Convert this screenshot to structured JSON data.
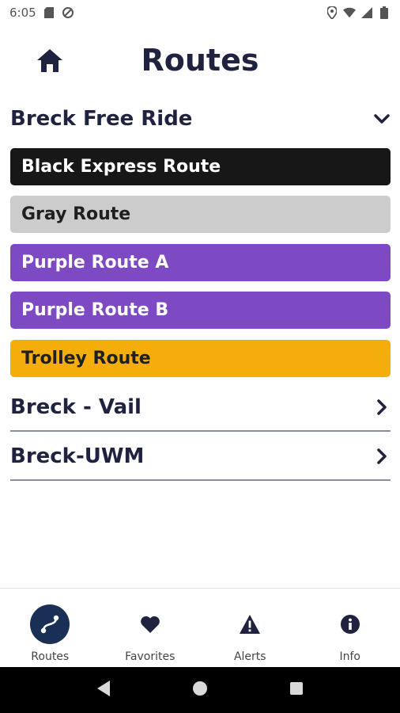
{
  "status_bar": {
    "time": "6:05"
  },
  "header": {
    "title": "Routes"
  },
  "groups": [
    {
      "title": "Breck Free Ride",
      "expanded": true,
      "routes": [
        {
          "label": "Black Express Route",
          "color": "#171717",
          "text_color": "#ffffff"
        },
        {
          "label": "Gray Route",
          "color": "#cccccc",
          "text_color": "#1f1f1f"
        },
        {
          "label": "Purple Route A",
          "color": "#7e4ac3",
          "text_color": "#ffffff"
        },
        {
          "label": "Purple Route B",
          "color": "#7e4ac3",
          "text_color": "#ffffff"
        },
        {
          "label": "Trolley Route",
          "color": "#f5ad0c",
          "text_color": "#1f1f1f"
        }
      ]
    },
    {
      "title": "Breck - Vail",
      "expanded": false
    },
    {
      "title": "Breck-UWM",
      "expanded": false
    }
  ],
  "bottom_nav": {
    "items": [
      {
        "label": "Routes",
        "icon": "route-icon",
        "active": true
      },
      {
        "label": "Favorites",
        "icon": "heart-icon",
        "active": false
      },
      {
        "label": "Alerts",
        "icon": "alert-icon",
        "active": false
      },
      {
        "label": "Info",
        "icon": "info-icon",
        "active": false
      }
    ]
  },
  "colors": {
    "primary": "#1f2340",
    "active_nav": "#1a2f55"
  }
}
